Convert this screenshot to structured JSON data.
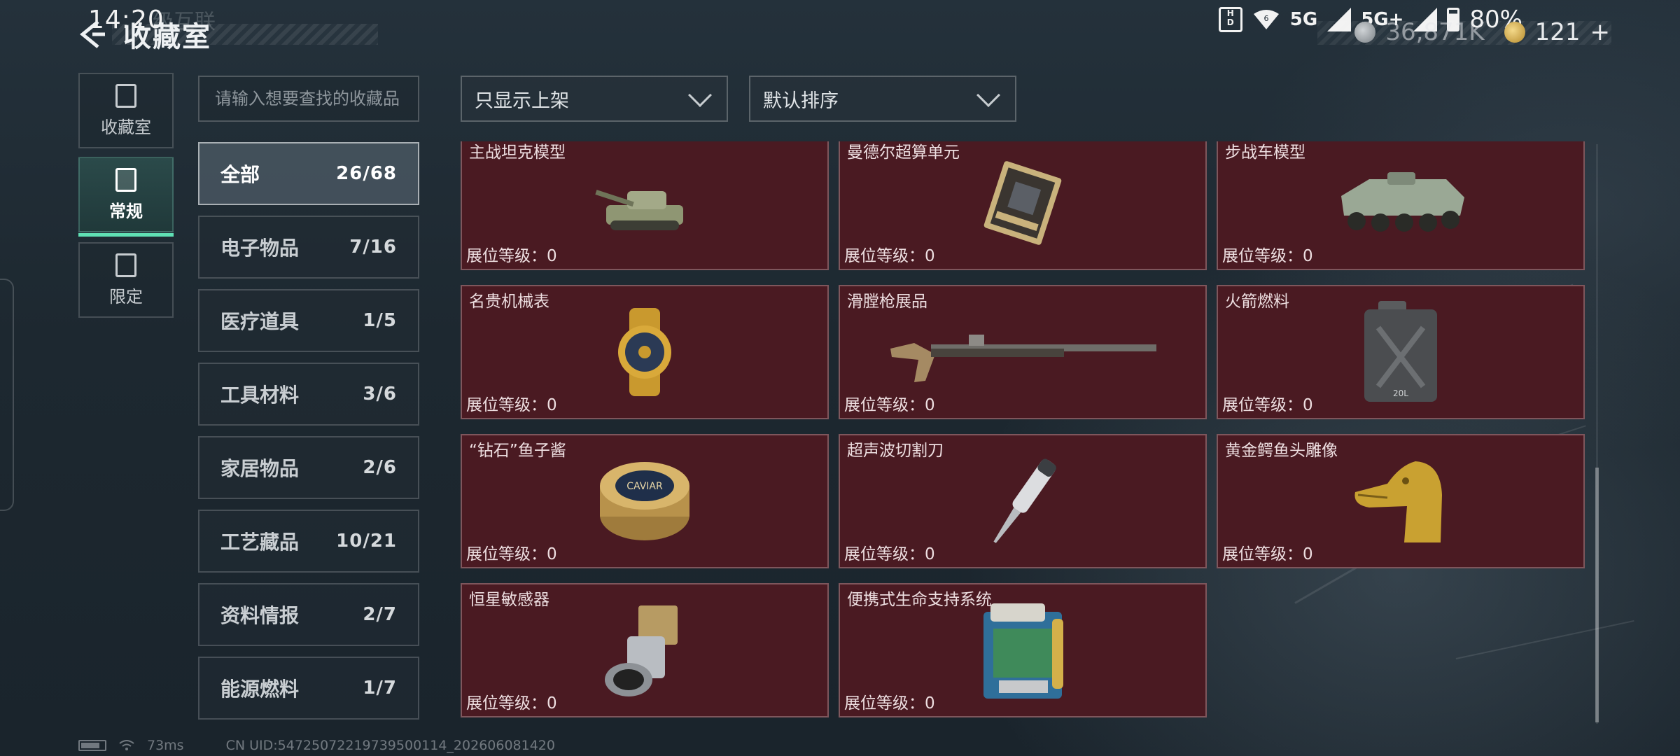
{
  "status_bar": {
    "time": "14:20",
    "network_1": "5G",
    "network_2": "5G+",
    "battery": "80%"
  },
  "header": {
    "title": "收藏室",
    "faint_subtitle": "级互联"
  },
  "currency": {
    "silver_value": "36,871K",
    "gold_value": "121",
    "gold_add": "+"
  },
  "rail": {
    "tabs": [
      {
        "label": "收藏室",
        "icon": "collection-icon"
      },
      {
        "label": "常规",
        "icon": "regular-icon"
      },
      {
        "label": "限定",
        "icon": "limited-icon"
      }
    ]
  },
  "search": {
    "placeholder": "请输入想要查找的收藏品"
  },
  "filters": {
    "show_filter": "只显示上架",
    "sort": "默认排序"
  },
  "categories": [
    {
      "name": "全部",
      "count": "26/68"
    },
    {
      "name": "电子物品",
      "count": "7/16"
    },
    {
      "name": "医疗道具",
      "count": "1/5"
    },
    {
      "name": "工具材料",
      "count": "3/6"
    },
    {
      "name": "家居物品",
      "count": "2/6"
    },
    {
      "name": "工艺藏品",
      "count": "10/21"
    },
    {
      "name": "资料情报",
      "count": "2/7"
    },
    {
      "name": "能源燃料",
      "count": "1/7"
    }
  ],
  "items": [
    {
      "name": "主战坦克模型",
      "level": "展位等级：0",
      "icon": "tank-model-icon"
    },
    {
      "name": "曼德尔超算单元",
      "level": "展位等级：0",
      "icon": "supercomputer-unit-icon"
    },
    {
      "name": "步战车模型",
      "level": "展位等级：0",
      "icon": "ifv-model-icon"
    },
    {
      "name": "名贵机械表",
      "level": "展位等级：0",
      "icon": "mechanical-watch-icon"
    },
    {
      "name": "滑膛枪展品",
      "level": "展位等级：0",
      "icon": "musket-icon"
    },
    {
      "name": "火箭燃料",
      "level": "展位等级：0",
      "icon": "fuel-canister-icon"
    },
    {
      "name": "“钻石”鱼子酱",
      "level": "展位等级：0",
      "icon": "caviar-tin-icon"
    },
    {
      "name": "超声波切割刀",
      "level": "展位等级：0",
      "icon": "ultrasonic-cutter-icon"
    },
    {
      "name": "黄金鳄鱼头雕像",
      "level": "展位等级：0",
      "icon": "gold-crocodile-statue-icon"
    },
    {
      "name": "恒星敏感器",
      "level": "展位等级：0",
      "icon": "star-sensor-icon"
    },
    {
      "name": "便携式生命支持系统",
      "level": "展位等级：0",
      "icon": "life-support-system-icon"
    }
  ],
  "item_art_text": {
    "caviar_label": "CAVIAR",
    "canister_label": "20L"
  },
  "footer": {
    "ping": "73ms",
    "uid": "CN UID:54725072219739500114_202606081420"
  },
  "colors": {
    "card_bg": "#4a1a22",
    "accent": "#5fe0b4",
    "background": "#1f2a33"
  }
}
